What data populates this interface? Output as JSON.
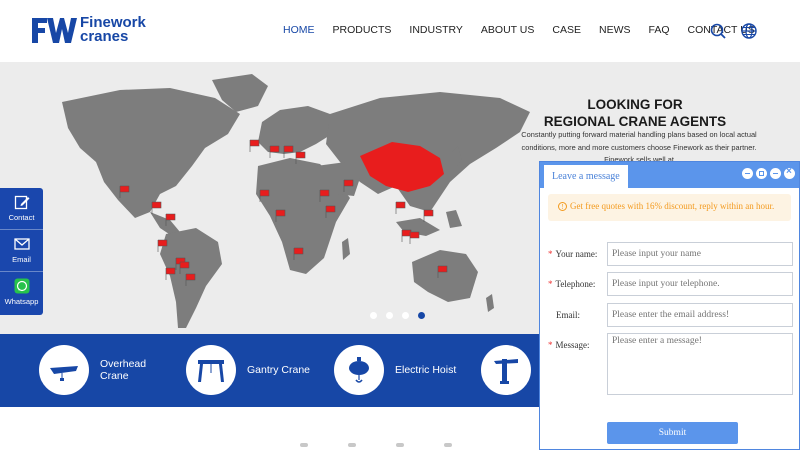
{
  "brand": {
    "line1": "Finework",
    "line2": "cranes",
    "color": "#1747a6"
  },
  "nav": [
    {
      "label": "HOME",
      "active": true
    },
    {
      "label": "PRODUCTS"
    },
    {
      "label": "INDUSTRY"
    },
    {
      "label": "ABOUT US"
    },
    {
      "label": "CASE"
    },
    {
      "label": "NEWS"
    },
    {
      "label": "FAQ"
    },
    {
      "label": "CONTACT US"
    }
  ],
  "header_icons": [
    "search-icon",
    "globe-icon"
  ],
  "hero": {
    "title_line1": "LOOKING FOR",
    "title_line2": "REGIONAL CRANE AGENTS",
    "subtitle": "Constantly putting forward material handling plans based on local actual conditions, more and more customers choose Finework as their partner. Finework sells well at",
    "slides": 4,
    "active_slide": 4
  },
  "side_bar": [
    {
      "label": "Contact",
      "icon": "edit-icon"
    },
    {
      "label": "Email",
      "icon": "mail-icon"
    },
    {
      "label": "Whatsapp",
      "icon": "whatsapp-icon"
    }
  ],
  "products": [
    {
      "label": "Overhead Crane",
      "icon": "overhead-crane-icon"
    },
    {
      "label": "Gantry Crane",
      "icon": "gantry-crane-icon"
    },
    {
      "label": "Electric Hoist",
      "icon": "electric-hoist-icon"
    },
    {
      "label": "",
      "icon": "jib-crane-icon"
    }
  ],
  "chat": {
    "tab_label": "Leave a message",
    "notice": "Get free quotes with 16% discount, reply within an hour.",
    "fields": {
      "name": {
        "label": "Your name:",
        "placeholder": "Please input your name",
        "required": true
      },
      "phone": {
        "label": "Telephone:",
        "placeholder": "Please input your telephone.",
        "required": true
      },
      "email": {
        "label": "Email:",
        "placeholder": "Please enter the email address!",
        "required": false
      },
      "message": {
        "label": "Message:",
        "placeholder": "Please enter a message!",
        "required": true
      }
    },
    "submit_label": "Submit",
    "accent": "#5b95eb",
    "notice_color": "#f39a1e"
  },
  "colors": {
    "primary": "#1747a6",
    "map_land": "#7d7d7d",
    "map_highlight": "#e81d1d",
    "hero_bg": "#ececec"
  }
}
